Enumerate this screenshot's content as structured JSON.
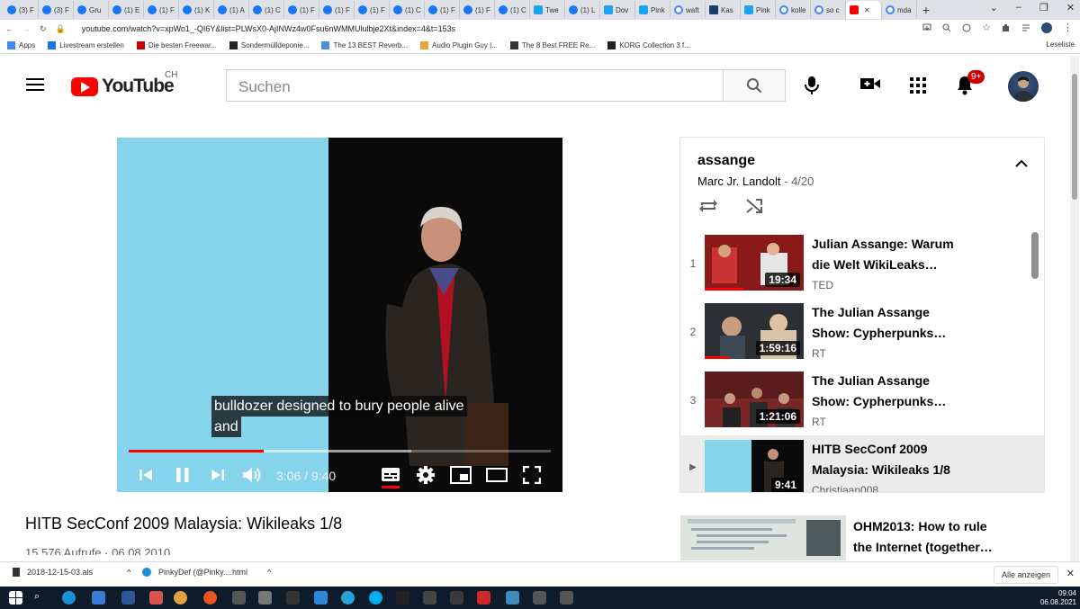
{
  "browser": {
    "tabs": [
      {
        "label": "(3) F",
        "icon": "facebook-icon"
      },
      {
        "label": "(3) F",
        "icon": "facebook-icon"
      },
      {
        "label": "Gru",
        "icon": "facebook-icon"
      },
      {
        "label": "(1) E",
        "icon": "facebook-icon"
      },
      {
        "label": "(1) F",
        "icon": "facebook-icon"
      },
      {
        "label": "(1) K",
        "icon": "facebook-icon"
      },
      {
        "label": "(1) A",
        "icon": "facebook-icon"
      },
      {
        "label": "(1) C",
        "icon": "facebook-icon"
      },
      {
        "label": "(1) F",
        "icon": "facebook-icon"
      },
      {
        "label": "(1) F",
        "icon": "facebook-icon"
      },
      {
        "label": "(1) F",
        "icon": "facebook-icon"
      },
      {
        "label": "(1) C",
        "icon": "facebook-icon"
      },
      {
        "label": "(1) F",
        "icon": "facebook-icon"
      },
      {
        "label": "(1) F",
        "icon": "facebook-icon"
      },
      {
        "label": "(1) C",
        "icon": "facebook-icon"
      },
      {
        "label": "Twe",
        "icon": "twitter-icon"
      },
      {
        "label": "(1) L",
        "icon": "facebook-icon"
      },
      {
        "label": "Dov",
        "icon": "twitter-icon"
      },
      {
        "label": "Pink",
        "icon": "twitter-icon"
      },
      {
        "label": "waft",
        "icon": "google-icon"
      },
      {
        "label": "Kas",
        "icon": "korg-icon"
      },
      {
        "label": "Pink",
        "icon": "twitter-icon"
      },
      {
        "label": "kolle",
        "icon": "google-icon"
      },
      {
        "label": "so c",
        "icon": "google-icon"
      },
      {
        "label": "",
        "icon": "youtube-icon"
      },
      {
        "label": "mda",
        "icon": "google-icon"
      }
    ],
    "url": "youtube.com/watch?v=xpWo1_-QI6Y&list=PLWsX0-AjINWz4w0Fsu6nWMMUlulbje2Xt&index=4&t=153s",
    "bookmarks": [
      {
        "label": "Apps"
      },
      {
        "label": "Livestream erstellen"
      },
      {
        "label": "Die besten Freewar..."
      },
      {
        "label": "Sondermülldeponie..."
      },
      {
        "label": "The 13 BEST Reverb..."
      },
      {
        "label": "Audio Plugin Guy |..."
      },
      {
        "label": "The 8 Best FREE Re..."
      },
      {
        "label": "KORG Collection 3 f..."
      }
    ],
    "leseliste": "Leseliste"
  },
  "masthead": {
    "logo_text": "YouTube",
    "country_code": "CH",
    "search_placeholder": "Suchen",
    "notification_count": "9+"
  },
  "player": {
    "subtitle_line1": "bulldozer designed to bury people alive",
    "subtitle_line2": "and",
    "time_display": "3:06 / 9:40",
    "progress": 0.32,
    "accent_color": "#ff0000"
  },
  "video": {
    "title": "HITB SecConf 2009 Malaysia: Wikileaks 1/8",
    "meta": "15.576 Aufrufe · 06.08.2010"
  },
  "playlist": {
    "title": "assange",
    "owner": "Marc Jr. Landolt",
    "position": "4/20",
    "items": [
      {
        "num": "1",
        "title_line1": "Julian Assange: Warum",
        "title_line2": "die Welt WikiLeaks…",
        "channel": "TED",
        "duration": "19:34"
      },
      {
        "num": "2",
        "title_line1": "The Julian Assange",
        "title_line2": "Show: Cypherpunks…",
        "channel": "RT",
        "duration": "1:59:16"
      },
      {
        "num": "3",
        "title_line1": "The Julian Assange",
        "title_line2": "Show: Cypherpunks…",
        "channel": "RT",
        "duration": "1:21:06"
      },
      {
        "num": "▶",
        "title_line1": "HITB SecConf 2009",
        "title_line2": "Malaysia: Wikileaks 1/8",
        "channel": "Christiaan008",
        "duration": "9:41"
      }
    ]
  },
  "next_up": {
    "title_line1": "OHM2013: How to rule",
    "title_line2": "the Internet (together…"
  },
  "downloads": [
    {
      "name": "2018-12-15-03.als"
    },
    {
      "name": "PinkyDef (@Pinky....html"
    }
  ],
  "downloads_show_all": "Alle anzeigen",
  "taskbar": {
    "time": "09:04",
    "date": "06.08.2021"
  }
}
